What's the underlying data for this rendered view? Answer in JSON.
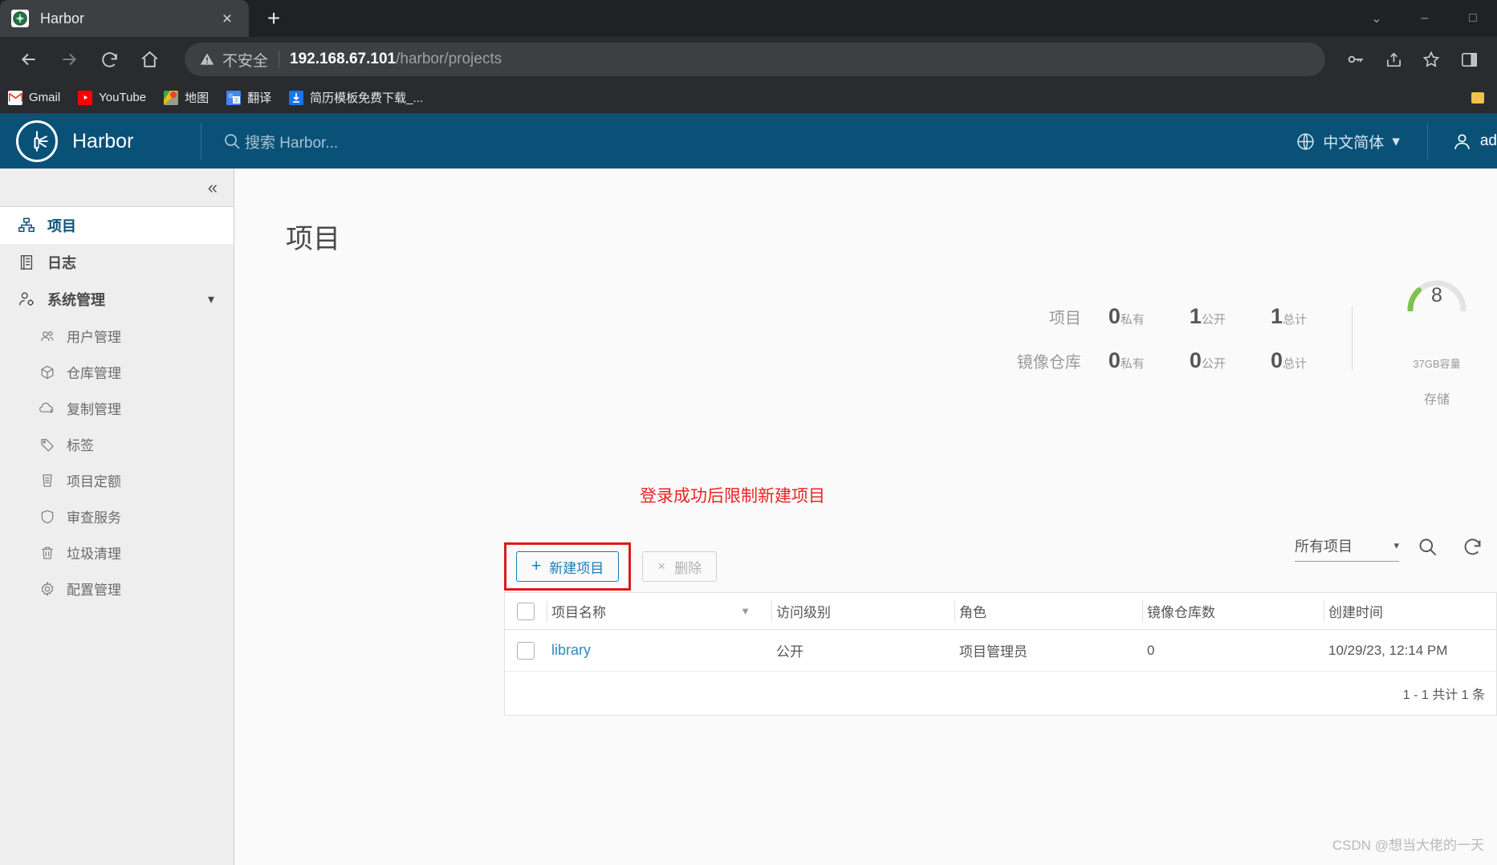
{
  "browser": {
    "tab": {
      "title": "Harbor",
      "favicon": "harbor-favicon",
      "close": "×"
    },
    "newtab_label": "+",
    "window_controls": {
      "minimize": "–",
      "maximize": "□",
      "close": "×",
      "chevron": "⌄"
    },
    "nav": {
      "back": "←",
      "forward": "→",
      "reload": "↻",
      "home": "⌂"
    },
    "omnibox": {
      "security_label": "不安全",
      "url_host": "192.168.67.101",
      "url_path": "/harbor/projects"
    },
    "toolbar_right": {
      "key": "key-icon",
      "share": "share-icon",
      "star": "star-icon",
      "sidepanel": "side-panel-icon"
    },
    "bookmarks": [
      {
        "label": "Gmail",
        "icon": "gmail-icon"
      },
      {
        "label": "YouTube",
        "icon": "youtube-icon"
      },
      {
        "label": "地图",
        "icon": "google-maps-icon"
      },
      {
        "label": "翻译",
        "icon": "google-translate-icon"
      },
      {
        "label": "简历模板免费下载_...",
        "icon": "download-icon"
      }
    ]
  },
  "harbor": {
    "header": {
      "brand": "Harbor",
      "search_placeholder": "搜索 Harbor...",
      "language": "中文简体",
      "account": "ad"
    },
    "sidebar": {
      "collapse": "«",
      "items": [
        {
          "label": "项目",
          "icon": "projects-icon",
          "active": true
        },
        {
          "label": "日志",
          "icon": "logs-icon",
          "active": false
        },
        {
          "label": "系统管理",
          "icon": "administration-icon",
          "active": false,
          "expandable": true
        }
      ],
      "sub_items": [
        {
          "label": "用户管理",
          "icon": "users-icon"
        },
        {
          "label": "仓库管理",
          "icon": "registry-icon"
        },
        {
          "label": "复制管理",
          "icon": "replication-icon"
        },
        {
          "label": "标签",
          "icon": "labels-icon"
        },
        {
          "label": "项目定额",
          "icon": "quota-icon"
        },
        {
          "label": "审查服务",
          "icon": "interrogation-services-icon"
        },
        {
          "label": "垃圾清理",
          "icon": "garbage-collection-icon"
        },
        {
          "label": "配置管理",
          "icon": "configuration-icon"
        }
      ]
    },
    "page": {
      "title": "项目",
      "annotation": "登录成功后限制新建项目"
    },
    "statistics": {
      "rows": [
        {
          "label": "项目",
          "cells": [
            {
              "num": "0",
              "unit": "私有"
            },
            {
              "num": "1",
              "unit": "公开"
            },
            {
              "num": "1",
              "unit": "总计"
            }
          ]
        },
        {
          "label": "镜像仓库",
          "cells": [
            {
              "num": "0",
              "unit": "私有"
            },
            {
              "num": "0",
              "unit": "公开"
            },
            {
              "num": "0",
              "unit": "总计"
            }
          ]
        }
      ],
      "gauge": {
        "value": "8",
        "capacity": "37GB容量",
        "label": "存储",
        "arc_color": "#7ec24d",
        "track_color": "#e3e3e3",
        "percent": 22
      }
    },
    "toolbar": {
      "new_project": "新建项目",
      "new_project_plus": "+",
      "delete": "删除",
      "delete_x": "×",
      "filter_select": "所有项目",
      "search_icon": "search-icon",
      "refresh_icon": "refresh-icon",
      "highlight_color": "#e01818"
    },
    "table": {
      "columns": [
        "项目名称",
        "访问级别",
        "角色",
        "镜像仓库数",
        "创建时间"
      ],
      "rows": [
        {
          "name": "library",
          "access": "公开",
          "role": "项目管理员",
          "repo_count": "0",
          "created": "10/29/23, 12:14 PM"
        }
      ],
      "footer": "1 - 1 共计 1 条"
    },
    "watermark": "CSDN @想当大佬的一天"
  }
}
